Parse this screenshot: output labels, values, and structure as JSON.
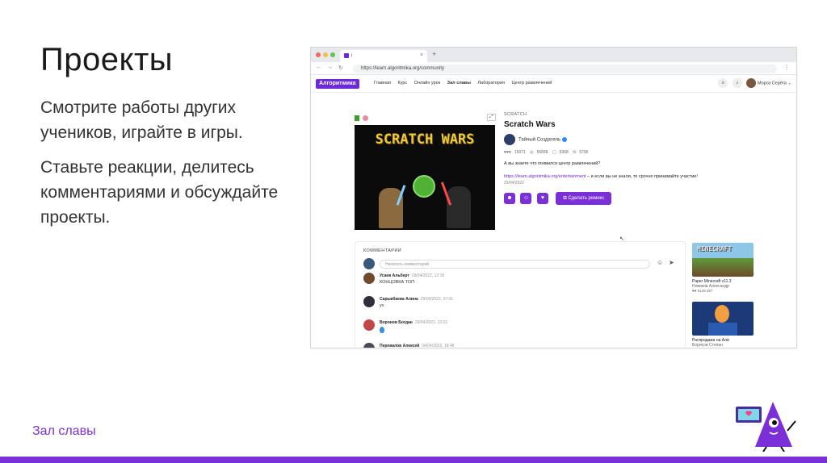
{
  "slide": {
    "title": "Проекты",
    "paragraph1": "Смотрите работы других учеников, играйте в игры.",
    "paragraph2": "Ставьте реакции, делитесь комментариями и обсуждайте проекты.",
    "footer_label": "Зал славы",
    "accent_color": "#7b2fd6"
  },
  "browser": {
    "tab_title": "i",
    "url": "https://learn.algoritmika.org/community"
  },
  "site": {
    "logo": "Алгоритмика",
    "menu": [
      "Главная",
      "Курс",
      "Онлайн урок",
      "Зал славы",
      "Лаборатория",
      "Центр развлечений"
    ],
    "active_menu": "Зал славы",
    "user_name": "Мороз Серёга"
  },
  "project": {
    "kicker": "SCRATCH",
    "title": "Scratch Wars",
    "stage_title": "SCRATCH WARS",
    "author": "Тайный Создатель",
    "stats": {
      "reactions": "15071",
      "views": "55838",
      "comments": "5368",
      "remixes": "5796"
    },
    "question": "А вы знаете что появился центр развлечений?",
    "link": "https://learn.algoritmika.org/entertainment",
    "link_suffix": " – и если вы не знали, то срочно принимайте участие!",
    "date": "29/04/2022",
    "remix_label": "Сделать ремикс"
  },
  "comments": {
    "title": "КОММЕНТАРИИ",
    "placeholder": "Написать комментарий",
    "items": [
      {
        "author": "Усаев Альберт",
        "date": "29/04/2022, 12:18",
        "text": "КОНЦОВКА ТОП"
      },
      {
        "author": "Сарыкбаева Алина",
        "date": "29/04/2022, 07:01",
        "text": "ух"
      },
      {
        "author": "Воронов Богдан",
        "date": "29/04/2022, 13:02",
        "text": ""
      },
      {
        "author": "Перевалов Алексей",
        "date": "04/04/2022, 18:48",
        "text": ""
      }
    ]
  },
  "sidebar": {
    "items": [
      {
        "title": "Paper Minecraft v11.3",
        "author": "Новиков Александр",
        "stats": "9129  257",
        "thumb_text": "MINECRAFT"
      },
      {
        "title": "Распродажа на Али",
        "author": "Борисов Степан",
        "stats": "",
        "thumb_text": ""
      }
    ]
  }
}
